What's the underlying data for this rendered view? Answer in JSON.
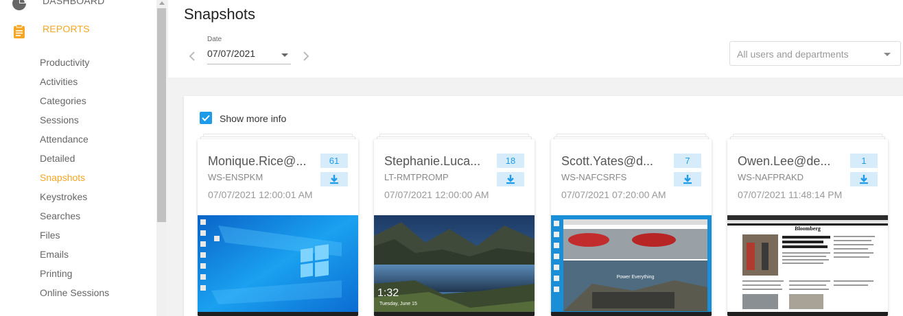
{
  "sidebar": {
    "dashboard_label": "DASHBOARD",
    "reports_label": "REPORTS",
    "items": [
      {
        "label": "Productivity"
      },
      {
        "label": "Activities"
      },
      {
        "label": "Categories"
      },
      {
        "label": "Sessions"
      },
      {
        "label": "Attendance"
      },
      {
        "label": "Detailed"
      },
      {
        "label": "Snapshots",
        "active": true
      },
      {
        "label": "Keystrokes"
      },
      {
        "label": "Searches"
      },
      {
        "label": "Files"
      },
      {
        "label": "Emails"
      },
      {
        "label": "Printing"
      },
      {
        "label": "Online Sessions"
      }
    ]
  },
  "header": {
    "title": "Snapshots",
    "date_label": "Date",
    "date_value": "07/07/2021",
    "users_placeholder": "All users and departments"
  },
  "options": {
    "show_more_info_label": "Show more info",
    "show_more_info_checked": true
  },
  "cards": [
    {
      "user": "Monique.Rice@...",
      "host": "WS-ENSPKM",
      "timestamp": "07/07/2021 12:00:01 AM",
      "count": "61",
      "thumbnail": "windows-desktop"
    },
    {
      "user": "Stephanie.Luca...",
      "host": "LT-RMTPROMP",
      "timestamp": "07/07/2021 12:00:00 AM",
      "count": "18",
      "thumbnail": "lock-screen-lake",
      "lock_time": "1:32",
      "lock_date": "Tuesday, June 15"
    },
    {
      "user": "Scott.Yates@d...",
      "host": "WS-NAFCSRFS",
      "timestamp": "07/07/2021 07:20:00 AM",
      "count": "7",
      "thumbnail": "browser-tesla",
      "overlay_text": "Power Everything"
    },
    {
      "user": "Owen.Lee@de...",
      "host": "WS-NAFPRAKD",
      "timestamp": "07/07/2021 11:48:14 PM",
      "count": "1",
      "thumbnail": "browser-bloomberg",
      "overlay_text": "Bloomberg"
    }
  ],
  "colors": {
    "accent_orange": "#f5a623",
    "accent_blue": "#1e9be8",
    "badge_bg": "#d6ecfb"
  }
}
